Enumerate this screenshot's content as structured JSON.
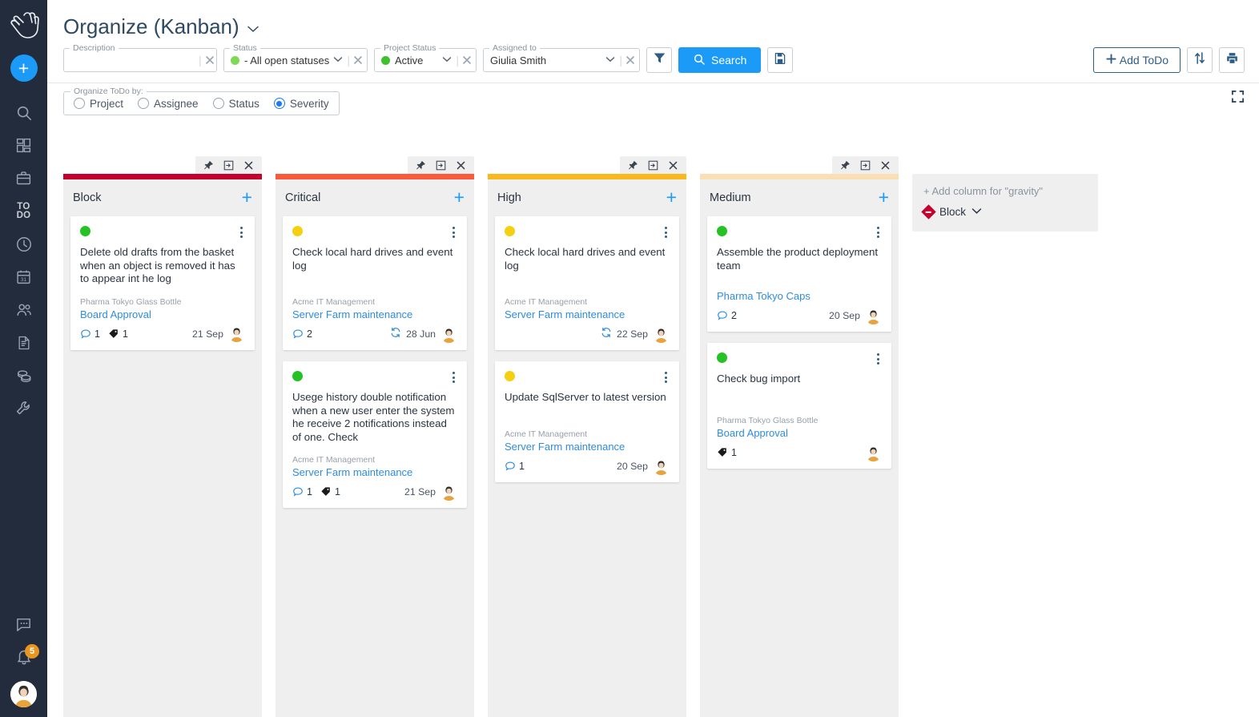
{
  "sidebar": {
    "logo_icon": "hand-logo",
    "add_button": "+",
    "items": [
      {
        "icon": "search-icon",
        "name": "search"
      },
      {
        "icon": "dashboard-icon",
        "name": "dashboard"
      },
      {
        "icon": "briefcase-icon",
        "name": "projects"
      },
      {
        "icon": "todo-text-icon",
        "name": "todo",
        "label_line1": "TO",
        "label_line2": "DO"
      },
      {
        "icon": "clock-icon",
        "name": "timesheet"
      },
      {
        "icon": "calendar-icon",
        "name": "calendar",
        "label": "31"
      },
      {
        "icon": "people-icon",
        "name": "resources"
      },
      {
        "icon": "document-icon",
        "name": "documents"
      },
      {
        "icon": "coins-icon",
        "name": "costs"
      },
      {
        "icon": "wrench-icon",
        "name": "tools"
      }
    ],
    "chat_icon": "chat-bubble-icon",
    "bell_icon": "bell-icon",
    "notification_count": "5",
    "avatar_icon": "user-avatar"
  },
  "header": {
    "title": "Organize (Kanban)",
    "caret_icon": "chevron-down-icon"
  },
  "toolbar": {
    "description": {
      "legend": "Description",
      "value": "",
      "placeholder": "",
      "clear_icon": "close-icon"
    },
    "status": {
      "legend": "Status",
      "value": "- All open statuses -",
      "dot_color": "#7ed957",
      "caret_icon": "chevron-down-icon",
      "clear_icon": "close-icon"
    },
    "project_status": {
      "legend": "Project Status",
      "value": "Active",
      "dot_color": "#3fc12f",
      "caret_icon": "chevron-down-icon",
      "clear_icon": "close-icon"
    },
    "assigned_to": {
      "legend": "Assigned to",
      "value": "Giulia Smith",
      "caret_icon": "chevron-down-icon",
      "clear_icon": "close-icon"
    },
    "filter_icon": "funnel-icon",
    "search_label": "Search",
    "search_icon": "search-icon",
    "save_icon": "save-disk-icon",
    "add_todo_label": "Add ToDo",
    "add_todo_icon": "plus-icon",
    "sort_icon": "sort-arrows-icon",
    "print_icon": "printer-icon",
    "accent_color": "#1b9af7"
  },
  "organize": {
    "legend": "Organize ToDo by:",
    "options": [
      {
        "label": "Project",
        "selected": false
      },
      {
        "label": "Assignee",
        "selected": false
      },
      {
        "label": "Status",
        "selected": false
      },
      {
        "label": "Severity",
        "selected": true
      }
    ],
    "fullscreen_icon": "fullscreen-icon"
  },
  "board": {
    "column_tools": {
      "pin_icon": "pin-icon",
      "collapse_icon": "collapse-box-icon",
      "close_icon": "close-icon"
    },
    "columns": [
      {
        "title": "Block",
        "bar_color": "#C4002E",
        "add_icon": "plus-icon",
        "cards": [
          {
            "dot_color": "#25c225",
            "title": "Delete old drafts from the basket when an object is removed it has to appear int he log",
            "project": "Pharma Tokyo Glass Bottle",
            "link": "Board Approval",
            "comments": "1",
            "tags": "1",
            "date": "21 Sep",
            "recurring": false
          }
        ]
      },
      {
        "title": "Critical",
        "bar_color": "#FA5A3C",
        "add_icon": "plus-icon",
        "cards": [
          {
            "dot_color": "#f5d010",
            "title": "Check local hard drives and event log",
            "project": "Acme IT Management",
            "link": "Server Farm maintenance",
            "comments": "2",
            "tags": null,
            "date": "28 Jun",
            "recurring": true
          },
          {
            "dot_color": "#25c225",
            "title": "Usege history double notification when a new user enter the system he receive 2 notifications instead of one. Check",
            "project": "Acme IT Management",
            "link": "Server Farm maintenance",
            "comments": "1",
            "tags": "1",
            "date": "21 Sep",
            "recurring": false
          }
        ]
      },
      {
        "title": "High",
        "bar_color": "#F9B81E",
        "add_icon": "plus-icon",
        "cards": [
          {
            "dot_color": "#f5d010",
            "title": "Check local hard drives and event log",
            "project": "Acme IT Management",
            "link": "Server Farm maintenance",
            "comments": null,
            "tags": null,
            "date": "22 Sep",
            "recurring": true
          },
          {
            "dot_color": "#f5d010",
            "title": "Update SqlServer to latest version",
            "project": "Acme IT Management",
            "link": "Server Farm maintenance",
            "comments": "1",
            "tags": null,
            "date": "20 Sep",
            "recurring": false
          }
        ]
      },
      {
        "title": "Medium",
        "bar_color": "#FADFB4",
        "add_icon": "plus-icon",
        "cards": [
          {
            "dot_color": "#25c225",
            "title": "Assemble the product deployment team",
            "project": null,
            "link": "Pharma Tokyo Caps",
            "comments": "2",
            "tags": null,
            "date": "20 Sep",
            "recurring": false
          },
          {
            "dot_color": "#25c225",
            "title": "Check bug import",
            "project": "Pharma Tokyo Glass Bottle",
            "link": "Board Approval",
            "comments": null,
            "tags": "1",
            "date": null,
            "recurring": false
          }
        ]
      }
    ],
    "add_column": {
      "label": "+ Add column for \"gravity\"",
      "value": "Block",
      "marker_color": "#C4002E",
      "caret_icon": "chevron-down-icon"
    }
  }
}
